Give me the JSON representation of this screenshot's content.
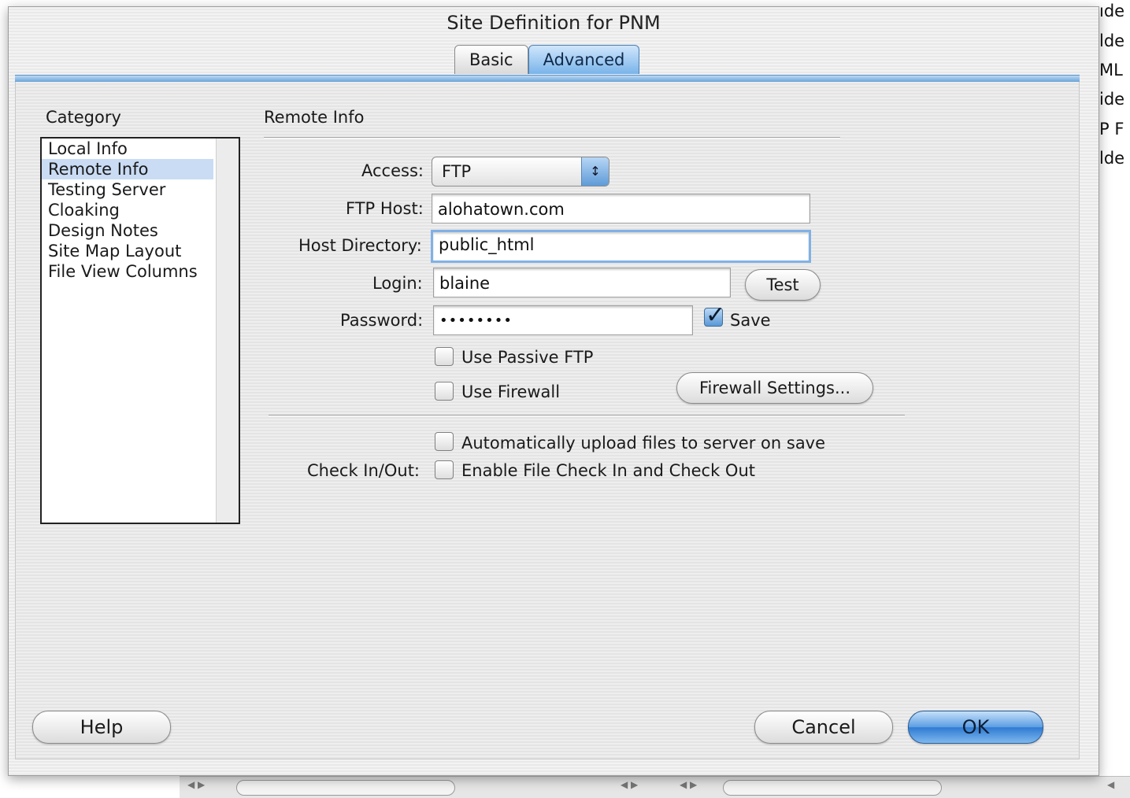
{
  "window": {
    "title": "Site Definition for PNM"
  },
  "tabs": [
    {
      "label": "Basic",
      "active": false
    },
    {
      "label": "Advanced",
      "active": true
    }
  ],
  "category": {
    "heading": "Category",
    "items": [
      "Local Info",
      "Remote Info",
      "Testing Server",
      "Cloaking",
      "Design Notes",
      "Site Map Layout",
      "File View Columns"
    ],
    "selected": "Remote Info"
  },
  "section": {
    "title": "Remote Info"
  },
  "form": {
    "access_label": "Access:",
    "access_value": "FTP",
    "ftp_host_label": "FTP Host:",
    "ftp_host_value": "alohatown.com",
    "host_dir_label": "Host Directory:",
    "host_dir_value": "public_html",
    "login_label": "Login:",
    "login_value": "blaine",
    "test_button": "Test",
    "password_label": "Password:",
    "password_value": "••••••••",
    "save_label": "Save",
    "save_checked": true,
    "passive_ftp_label": "Use Passive FTP",
    "passive_ftp_checked": false,
    "firewall_label": "Use Firewall",
    "firewall_checked": false,
    "firewall_settings_button": "Firewall Settings...",
    "auto_upload_label": "Automatically upload files to server on save",
    "auto_upload_checked": false,
    "checkinout_label": "Check In/Out:",
    "enable_checkinout_label": "Enable File Check In and Check Out",
    "enable_checkinout_checked": false
  },
  "footer": {
    "help": "Help",
    "cancel": "Cancel",
    "ok": "OK"
  },
  "background_window": {
    "fragments": [
      "ıde",
      "lde",
      "ML",
      "ide",
      "P F",
      "lde"
    ]
  },
  "colors": {
    "accent": "#5b9de3",
    "selection": "#c9dcf4"
  }
}
